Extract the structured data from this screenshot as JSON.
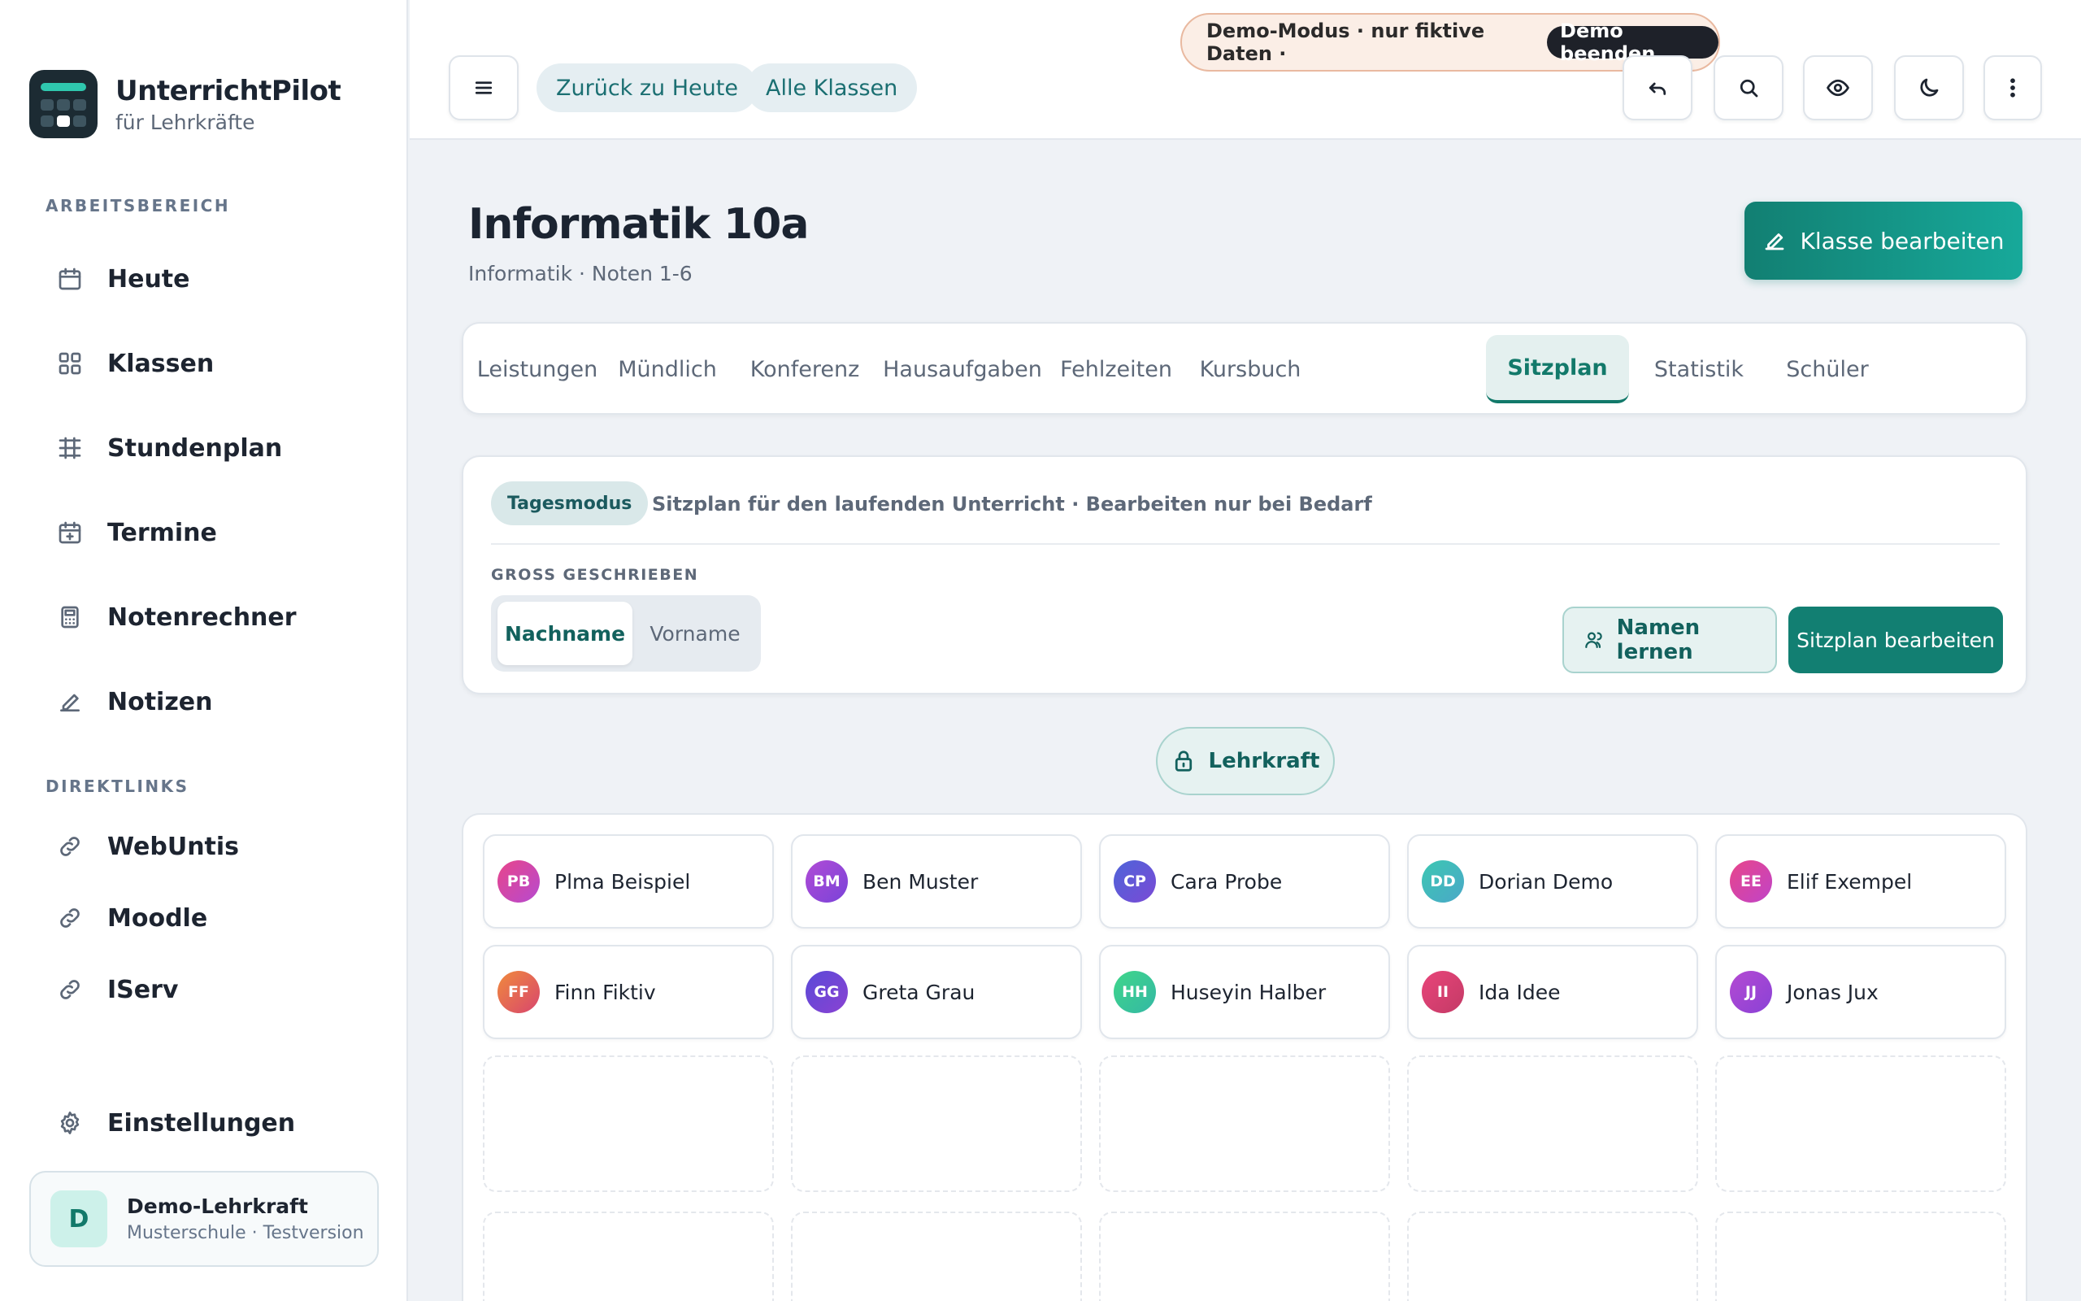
{
  "brand": {
    "name": "UnterrichtPilot",
    "subtitle": "für Lehrkräfte"
  },
  "sidebar": {
    "section_workspace": "ARBEITSBEREICH",
    "workspace_items": [
      {
        "label": "Heute",
        "icon": "calendar-icon"
      },
      {
        "label": "Klassen",
        "icon": "grid-icon"
      },
      {
        "label": "Stundenplan",
        "icon": "timetable-icon"
      },
      {
        "label": "Termine",
        "icon": "calendar-plus-icon"
      },
      {
        "label": "Notenrechner",
        "icon": "calculator-icon"
      },
      {
        "label": "Notizen",
        "icon": "pencil-icon"
      }
    ],
    "section_links": "DIREKTLINKS",
    "link_items": [
      {
        "label": "WebUntis",
        "icon": "link-icon"
      },
      {
        "label": "Moodle",
        "icon": "link-icon"
      },
      {
        "label": "IServ",
        "icon": "link-icon"
      }
    ],
    "settings": {
      "label": "Einstellungen",
      "icon": "gear-icon"
    },
    "user": {
      "initial": "D",
      "name": "Demo-Lehrkraft",
      "sub": "Musterschule · Testversion"
    }
  },
  "topbar": {
    "back_today": "Zurück zu Heute",
    "all_classes": "Alle Klassen",
    "demo_text": "Demo-Modus · nur fiktive Daten ·",
    "demo_end": "Demo beenden"
  },
  "page": {
    "title": "Informatik 10a",
    "subtitle": "Informatik · Noten 1-6",
    "edit_class": "Klasse bearbeiten"
  },
  "tabs": [
    {
      "label": "Leistungen",
      "active": false
    },
    {
      "label": "Mündlich",
      "active": false
    },
    {
      "label": "Konferenz",
      "active": false
    },
    {
      "label": "Hausaufgaben",
      "active": false
    },
    {
      "label": "Fehlzeiten",
      "active": false
    },
    {
      "label": "Kursbuch",
      "active": false
    },
    {
      "label": "Sitzplan",
      "active": true
    },
    {
      "label": "Statistik",
      "active": false
    },
    {
      "label": "Schüler",
      "active": false
    }
  ],
  "seating": {
    "mode_badge": "Tagesmodus",
    "mode_desc": "Sitzplan für den laufenden Unterricht · Bearbeiten nur bei Bedarf",
    "case_label": "GROSS GESCHRIEBEN",
    "seg_on": "Nachname",
    "seg_off": "Vorname",
    "learn_names": "Namen lernen",
    "edit_seating": "Sitzplan bearbeiten",
    "teacher": "Lehrkraft"
  },
  "students": [
    {
      "initials": "PB",
      "name": "Plma Beispiel",
      "color": "#d83f8f"
    },
    {
      "initials": "BM",
      "name": "Ben Muster",
      "color": "#9a45d6"
    },
    {
      "initials": "CP",
      "name": "Cara Probe",
      "color": "#5a58d4"
    },
    {
      "initials": "DD",
      "name": "Dorian Demo",
      "color": "#3fb9b0"
    },
    {
      "initials": "EE",
      "name": "Elif Exempel",
      "color": "#d83f9e"
    },
    {
      "initials": "FF",
      "name": "Finn Fiktiv",
      "color": "#e0704a"
    },
    {
      "initials": "GG",
      "name": "Greta Grau",
      "color": "#6a44d6"
    },
    {
      "initials": "HH",
      "name": "Huseyin Halber",
      "color": "#3fcf8e"
    },
    {
      "initials": "II",
      "name": "Ida Idee",
      "color": "#d6436e"
    },
    {
      "initials": "JJ",
      "name": "Jonas Jux",
      "color": "#a845d0"
    }
  ]
}
